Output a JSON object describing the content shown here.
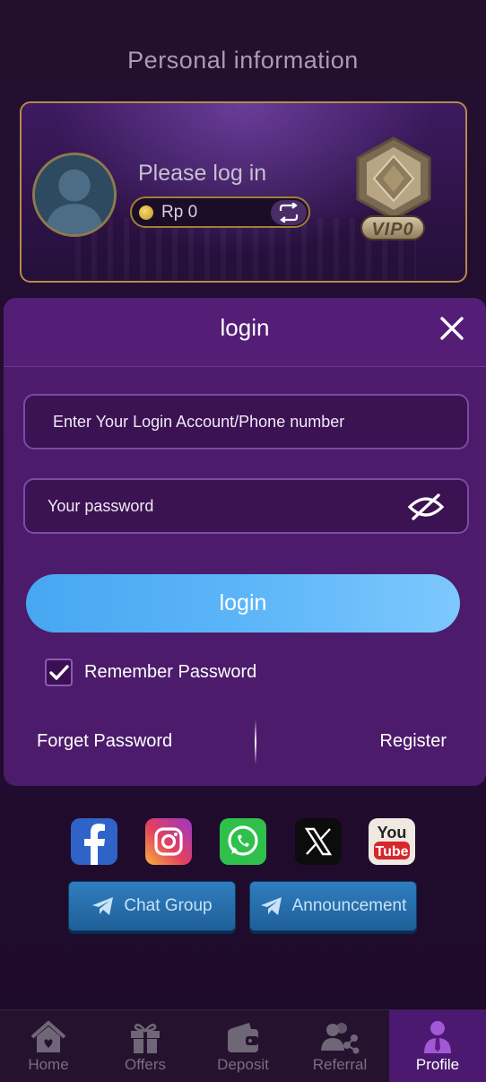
{
  "page": {
    "title": "Personal information"
  },
  "profile": {
    "login_prompt": "Please log in",
    "balance": "Rp 0",
    "vip_label": "VIP0"
  },
  "login_modal": {
    "title": "login",
    "account_placeholder": "Enter Your Login Account/Phone number",
    "password_placeholder": "Your password",
    "login_button": "login",
    "remember_label": "Remember Password",
    "remember_checked": true,
    "forget_label": "Forget Password",
    "register_label": "Register"
  },
  "social": {
    "icons": [
      "facebook-icon",
      "instagram-icon",
      "whatsapp-icon",
      "x-icon",
      "youtube-icon"
    ],
    "chat_group_label": "Chat Group",
    "announcement_label": "Announcement"
  },
  "tabbar": {
    "items": [
      {
        "label": "Home",
        "icon": "home-icon"
      },
      {
        "label": "Offers",
        "icon": "gift-icon"
      },
      {
        "label": "Deposit",
        "icon": "wallet-icon"
      },
      {
        "label": "Referral",
        "icon": "referral-icon"
      },
      {
        "label": "Profile",
        "icon": "profile-icon"
      }
    ],
    "active_index": 4
  },
  "colors": {
    "accent_blue": "#5cb5f8",
    "modal_purple": "#4c1b6b",
    "gold_border": "#b38a4c"
  }
}
